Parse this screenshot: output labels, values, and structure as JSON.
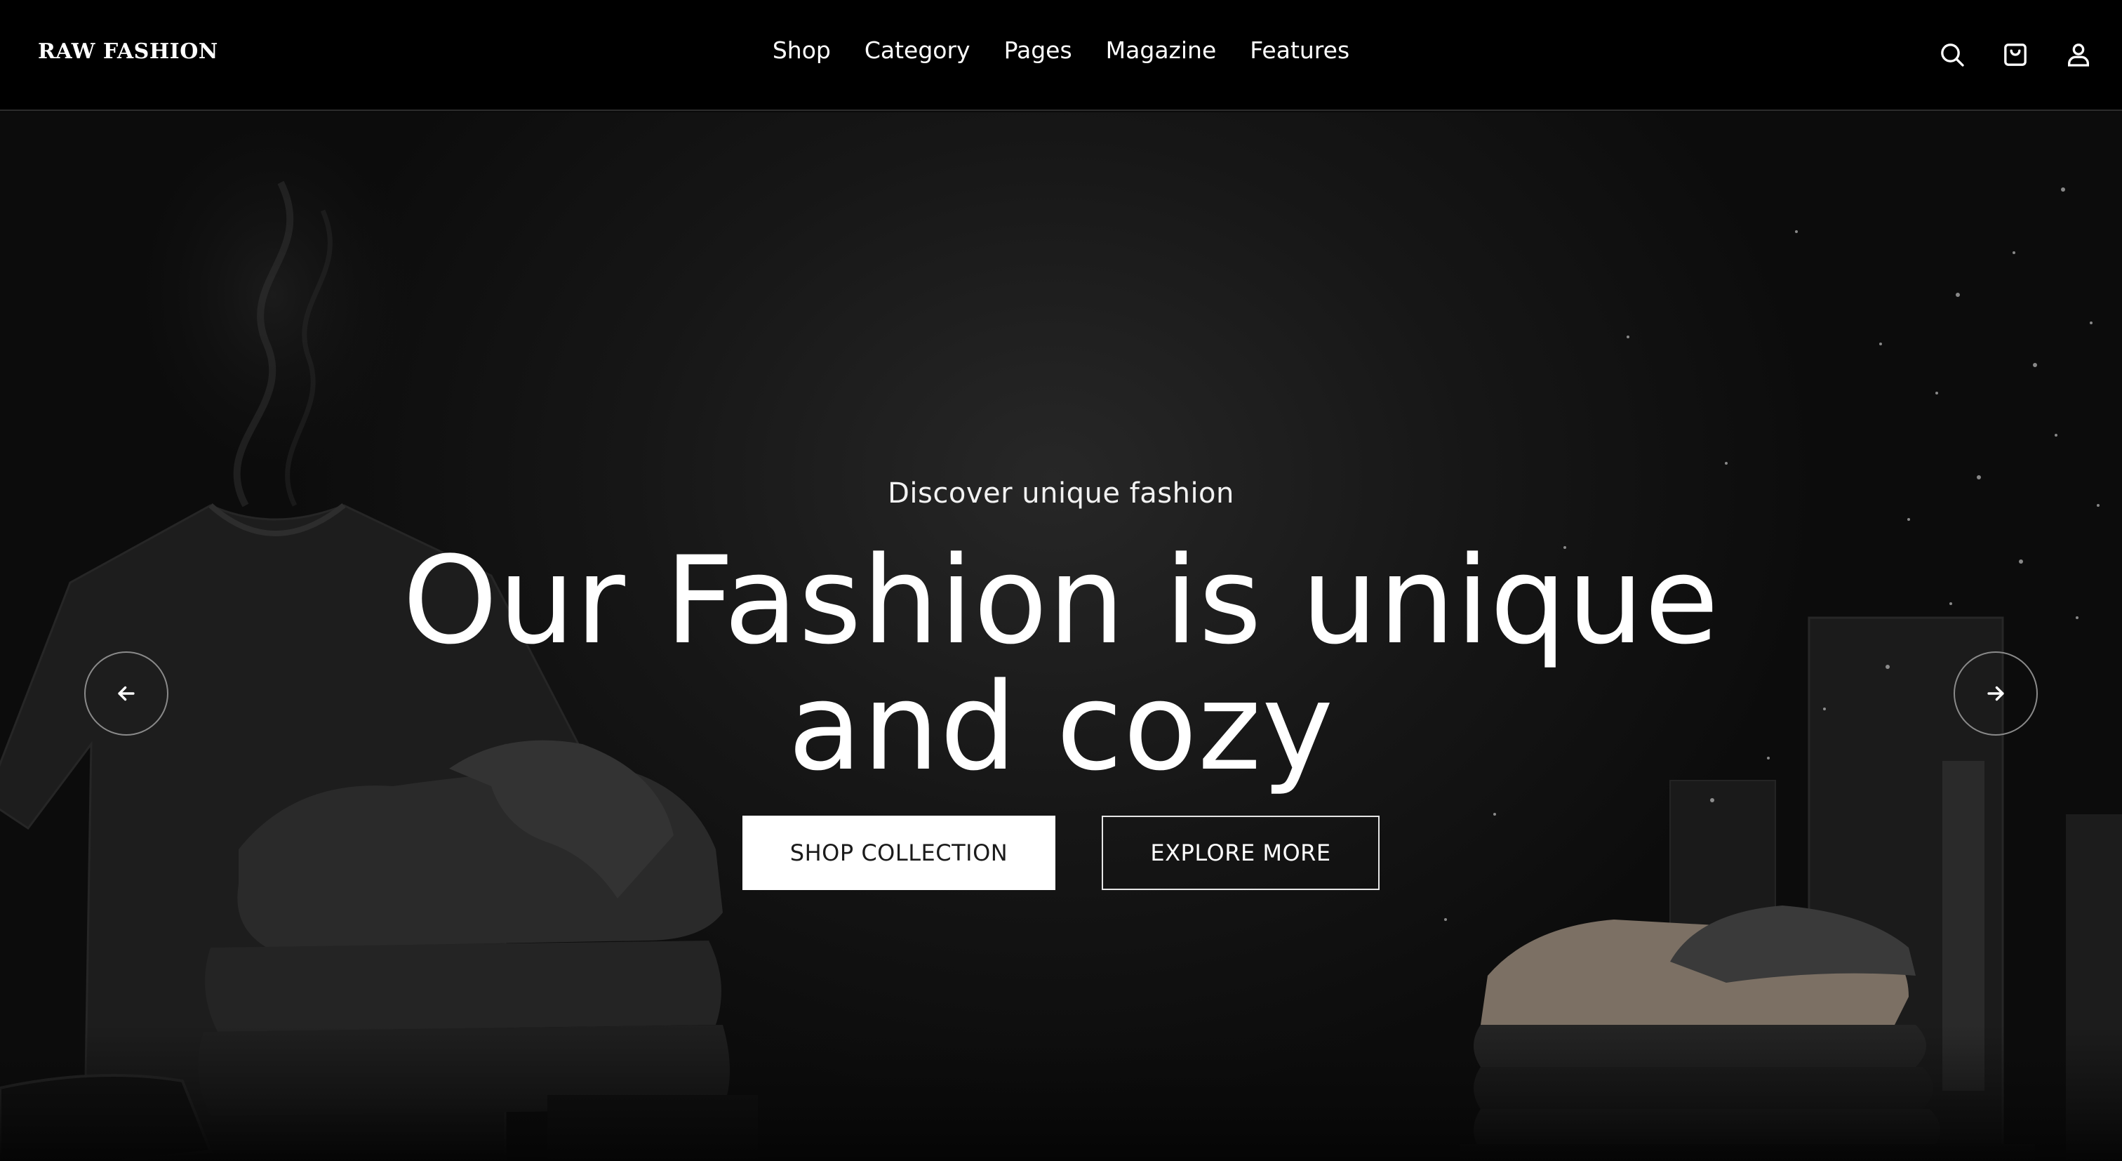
{
  "brand": {
    "name": "RAW FASHION"
  },
  "nav": {
    "items": [
      "Shop",
      "Category",
      "Pages",
      "Magazine",
      "Features"
    ]
  },
  "header_icons": [
    "search-icon",
    "cart-icon",
    "user-icon"
  ],
  "hero": {
    "subtitle": "Discover unique fashion",
    "headline_line1": "Our Fashion is unique",
    "headline_line2": "and cozy",
    "primary_button": "SHOP COLLECTION",
    "secondary_button": "EXPLORE MORE",
    "prev_icon": "arrow-left-icon",
    "next_icon": "arrow-right-icon"
  },
  "colors": {
    "header_bg": "#000000",
    "hero_bg": "#161616",
    "text": "#ffffff",
    "primary_button_bg": "#ffffff",
    "primary_button_text": "#1b1b1b"
  }
}
